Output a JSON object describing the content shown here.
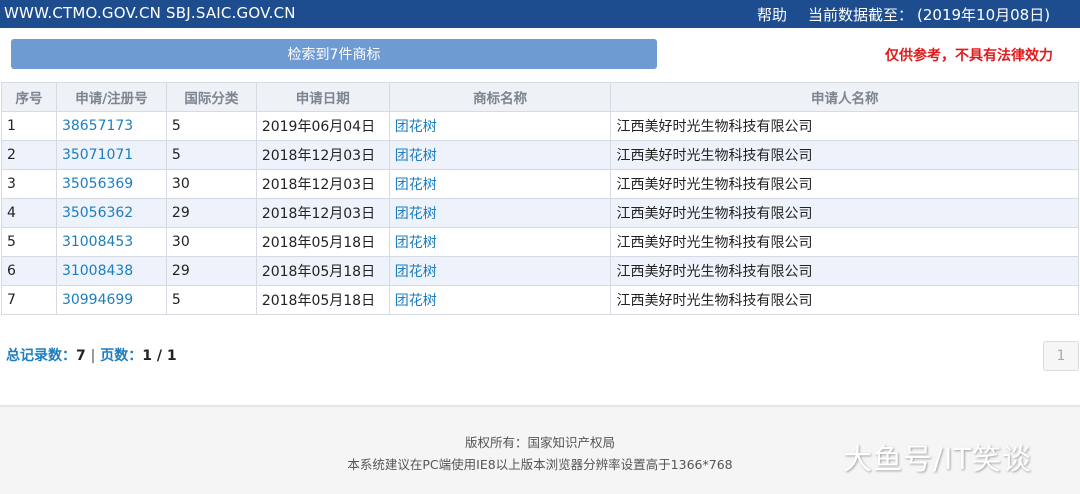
{
  "topbar": {
    "site": "WWW.CTMO.GOV.CN SBJ.SAIC.GOV.CN",
    "help": "帮助",
    "date_label": "当前数据截至：",
    "date_value": "(2019年10月08日)"
  },
  "search_button": "检索到7件商标",
  "disclaimer": "仅供参考，不具有法律效力",
  "table": {
    "headers": [
      "序号",
      "申请/注册号",
      "国际分类",
      "申请日期",
      "商标名称",
      "申请人名称"
    ],
    "rows": [
      {
        "no": "1",
        "reg": "38657173",
        "cls": "5",
        "date": "2019年06月04日",
        "name": "团花树",
        "applicant": "江西美好时光生物科技有限公司"
      },
      {
        "no": "2",
        "reg": "35071071",
        "cls": "5",
        "date": "2018年12月03日",
        "name": "团花树",
        "applicant": "江西美好时光生物科技有限公司"
      },
      {
        "no": "3",
        "reg": "35056369",
        "cls": "30",
        "date": "2018年12月03日",
        "name": "团花树",
        "applicant": "江西美好时光生物科技有限公司"
      },
      {
        "no": "4",
        "reg": "35056362",
        "cls": "29",
        "date": "2018年12月03日",
        "name": "团花树",
        "applicant": "江西美好时光生物科技有限公司"
      },
      {
        "no": "5",
        "reg": "31008453",
        "cls": "30",
        "date": "2018年05月18日",
        "name": "团花树",
        "applicant": "江西美好时光生物科技有限公司"
      },
      {
        "no": "6",
        "reg": "31008438",
        "cls": "29",
        "date": "2018年05月18日",
        "name": "团花树",
        "applicant": "江西美好时光生物科技有限公司"
      },
      {
        "no": "7",
        "reg": "30994699",
        "cls": "5",
        "date": "2018年05月18日",
        "name": "团花树",
        "applicant": "江西美好时光生物科技有限公司"
      }
    ]
  },
  "summary": {
    "total_label": "总记录数：",
    "total_value": "7",
    "divider": "|",
    "pages_label": "页数：",
    "pages_value": "1 / 1"
  },
  "pagination": {
    "current": "1"
  },
  "footer": {
    "copyright": "版权所有：国家知识产权局",
    "recommendation": "本系统建议在PC端使用IE8以上版本浏览器分辨率设置高于1366*768"
  },
  "watermark": "大鱼号/IT笑谈"
}
